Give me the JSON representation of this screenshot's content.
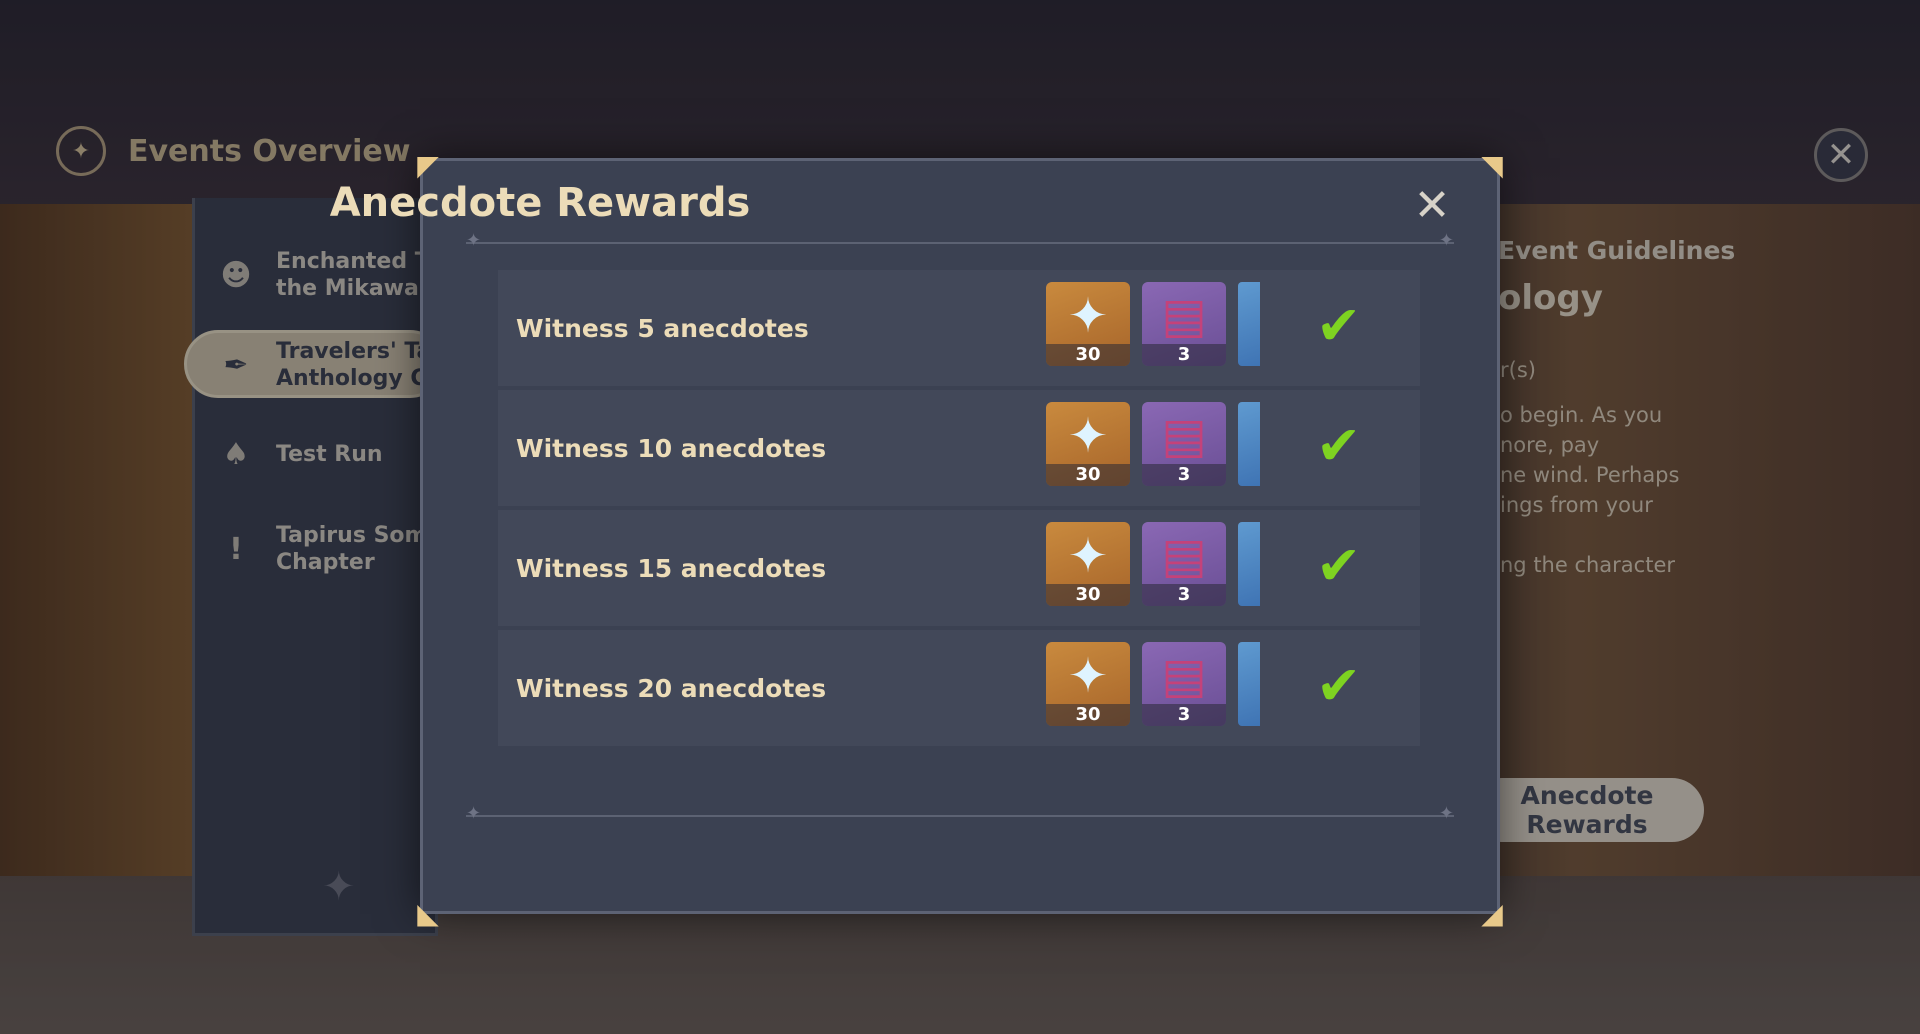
{
  "header": {
    "title": "Events Overview"
  },
  "nav": {
    "items": [
      {
        "label": "Enchanted Tal\nthe Mikawa Fe",
        "icon": "raccoon-icon",
        "active": false
      },
      {
        "label": "Travelers' Ta\nAnthology Ch",
        "icon": "quill-icon",
        "active": true
      },
      {
        "label": "Test Run",
        "icon": "cards-icon",
        "active": false
      },
      {
        "label": "Tapirus Somn\nChapter",
        "icon": "exclamation-icon",
        "active": false
      }
    ]
  },
  "background_panel": {
    "guidelines": "Event Guidelines",
    "subtitle": "ology",
    "time": "r(s)",
    "text": "o begin. As you\nnore, pay\nne wind. Perhaps\nings from your\n\nng the character",
    "button": "Anecdote\nRewards"
  },
  "dialog": {
    "title": "Anecdote Rewards",
    "rows": [
      {
        "label": "Witness 5 anecdotes",
        "reward_primogem": "30",
        "reward_book": "3",
        "claimed": true
      },
      {
        "label": "Witness 10 anecdotes",
        "reward_primogem": "30",
        "reward_book": "3",
        "claimed": true
      },
      {
        "label": "Witness 15 anecdotes",
        "reward_primogem": "30",
        "reward_book": "3",
        "claimed": true
      },
      {
        "label": "Witness 20 anecdotes",
        "reward_primogem": "30",
        "reward_book": "3",
        "claimed": true
      }
    ]
  },
  "colors": {
    "accent_gold": "#ecdcb8",
    "check_green": "#7ed321",
    "panel": "#3b4152"
  }
}
